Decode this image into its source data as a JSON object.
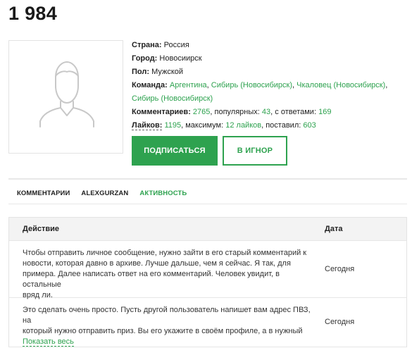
{
  "profile": {
    "title": "1 984",
    "country_label": "Страна:",
    "country_value": "Россия",
    "city_label": "Город:",
    "city_value": "Новосиирск",
    "gender_label": "Пол:",
    "gender_value": "Мужской",
    "team_label": "Команда:",
    "teams": [
      "Аргентина",
      "Сибирь (Новосибирск)",
      "Чкаловец (Новосибирск)",
      "Сибирь (Новосибирск)"
    ],
    "comments_label": "Комментариев:",
    "comments_count": "2765",
    "popular_label": ", популярных:",
    "popular_count": "43",
    "answers_label": ", с ответами:",
    "answers_count": "169",
    "likes_label": "Лайков:",
    "likes_count": "1195",
    "max_label": ", максимум:",
    "max_value": "12 лайков",
    "given_label": ", поставил:",
    "given_count": "603"
  },
  "buttons": {
    "subscribe": "ПОДПИСАТЬСЯ",
    "ignore": "В ИГНОР"
  },
  "tabs": [
    {
      "label": "КОММЕНТАРИИ",
      "active": false
    },
    {
      "label": "ALEXGURZAN",
      "active": false
    },
    {
      "label": "АКТИВНОСТЬ",
      "active": true
    }
  ],
  "table": {
    "col_action": "Действие",
    "col_date": "Дата",
    "rows": [
      {
        "text_lines": [
          "Чтобы отправить личное сообщение, нужно зайти в его старый комментарий к",
          "новости, которая давно в архиве. Лучше дальше, чем я сейчас. Я так, для",
          "примера. Далее написать ответ на его комментарий. Человек увидит, в остальные",
          "вряд ли."
        ],
        "date": "Сегодня"
      },
      {
        "text_lines": [
          "Это сделать очень просто. Пусть другой пользователь напишет вам адрес ПВЗ, на",
          "который нужно отправить приз. Вы его укажите в своём профиле, а в нужный"
        ],
        "show_all": "Показать весь",
        "date": "Сегодня"
      }
    ]
  },
  "colors": {
    "accent": "#2ea24f",
    "text": "#222222",
    "header_bg": "#f3f3f3",
    "border": "#e3e3e3"
  },
  "icons": {
    "avatar": "user-silhouette-icon"
  }
}
